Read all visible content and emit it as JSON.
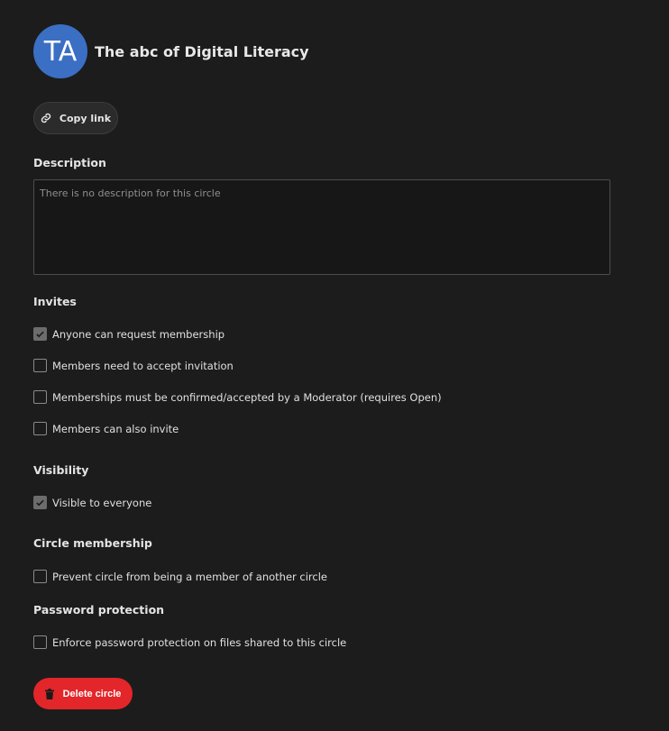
{
  "circle": {
    "avatar_initials": "TA",
    "name": "The abc of Digital Literacy"
  },
  "actions": {
    "copy_link": "Copy link",
    "delete": "Delete circle"
  },
  "description": {
    "heading": "Description",
    "placeholder": "There is no description for this circle",
    "value": ""
  },
  "invites": {
    "heading": "Invites",
    "options": [
      {
        "label": "Anyone can request membership",
        "checked": true
      },
      {
        "label": "Members need to accept invitation",
        "checked": false
      },
      {
        "label": "Memberships must be confirmed/accepted by a Moderator (requires Open)",
        "checked": false
      },
      {
        "label": "Members can also invite",
        "checked": false
      }
    ]
  },
  "visibility": {
    "heading": "Visibility",
    "options": [
      {
        "label": "Visible to everyone",
        "checked": true
      }
    ]
  },
  "circle_membership": {
    "heading": "Circle membership",
    "options": [
      {
        "label": "Prevent circle from being a member of another circle",
        "checked": false
      }
    ]
  },
  "password_protection": {
    "heading": "Password protection",
    "options": [
      {
        "label": "Enforce password protection on files shared to this circle",
        "checked": false
      }
    ]
  },
  "colors": {
    "avatar": "#3a6fc4",
    "danger": "#e3262a",
    "background": "#1c1c1c"
  },
  "icons": {
    "copy": "link-icon",
    "delete": "trash-icon",
    "check": "checkmark-icon"
  }
}
